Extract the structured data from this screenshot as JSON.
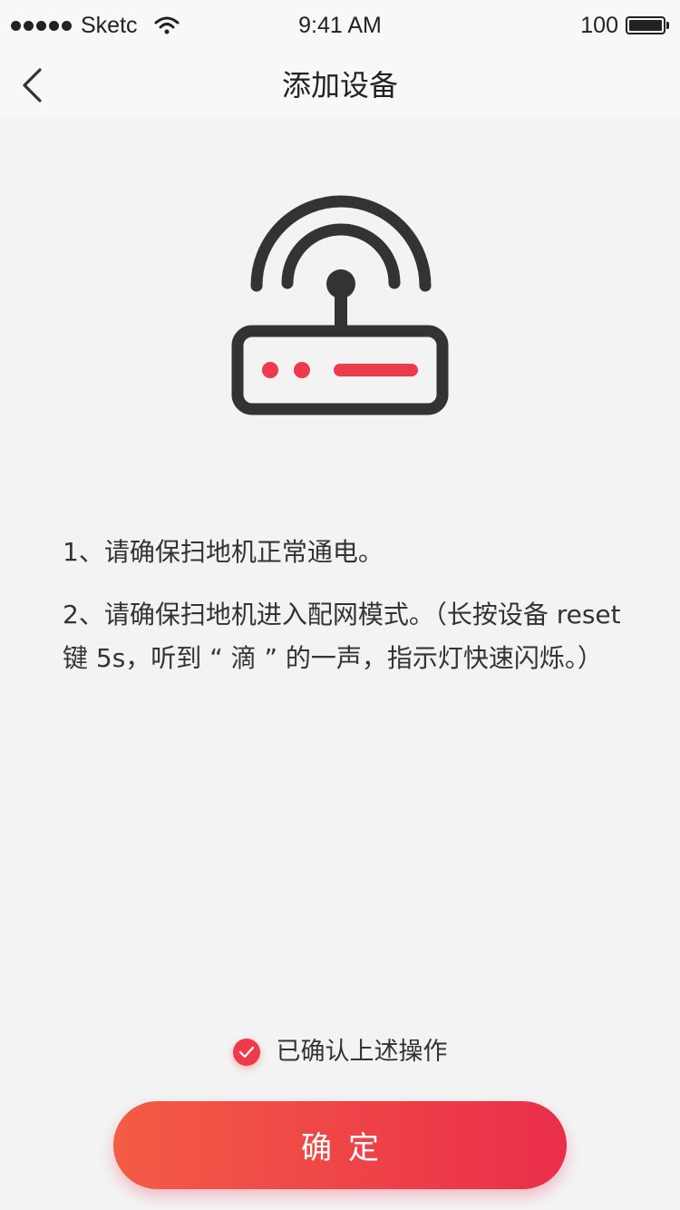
{
  "status_bar": {
    "carrier": "Sketc",
    "time": "9:41 AM",
    "battery": "100"
  },
  "nav": {
    "title": "添加设备",
    "back_icon": "chevron-left-icon"
  },
  "illustration": {
    "icon": "router-icon",
    "frame_color": "#333333",
    "indicator_color": "#ee3b4c"
  },
  "instructions": [
    "1、请确保扫地机正常通电。",
    "2、请确保扫地机进入配网模式。（长按设备 reset 键 5s，听到 “ 滴 ” 的一声，指示灯快速闪烁。）"
  ],
  "confirm": {
    "label": "已确认上述操作",
    "checked": true,
    "icon": "checkmark-icon"
  },
  "submit_button": {
    "label": "确定"
  },
  "colors": {
    "accent": "#ee3b4c",
    "button_gradient_start": "#f35c45",
    "button_gradient_end": "#ea2e4a",
    "background": "#f3f3f3"
  }
}
